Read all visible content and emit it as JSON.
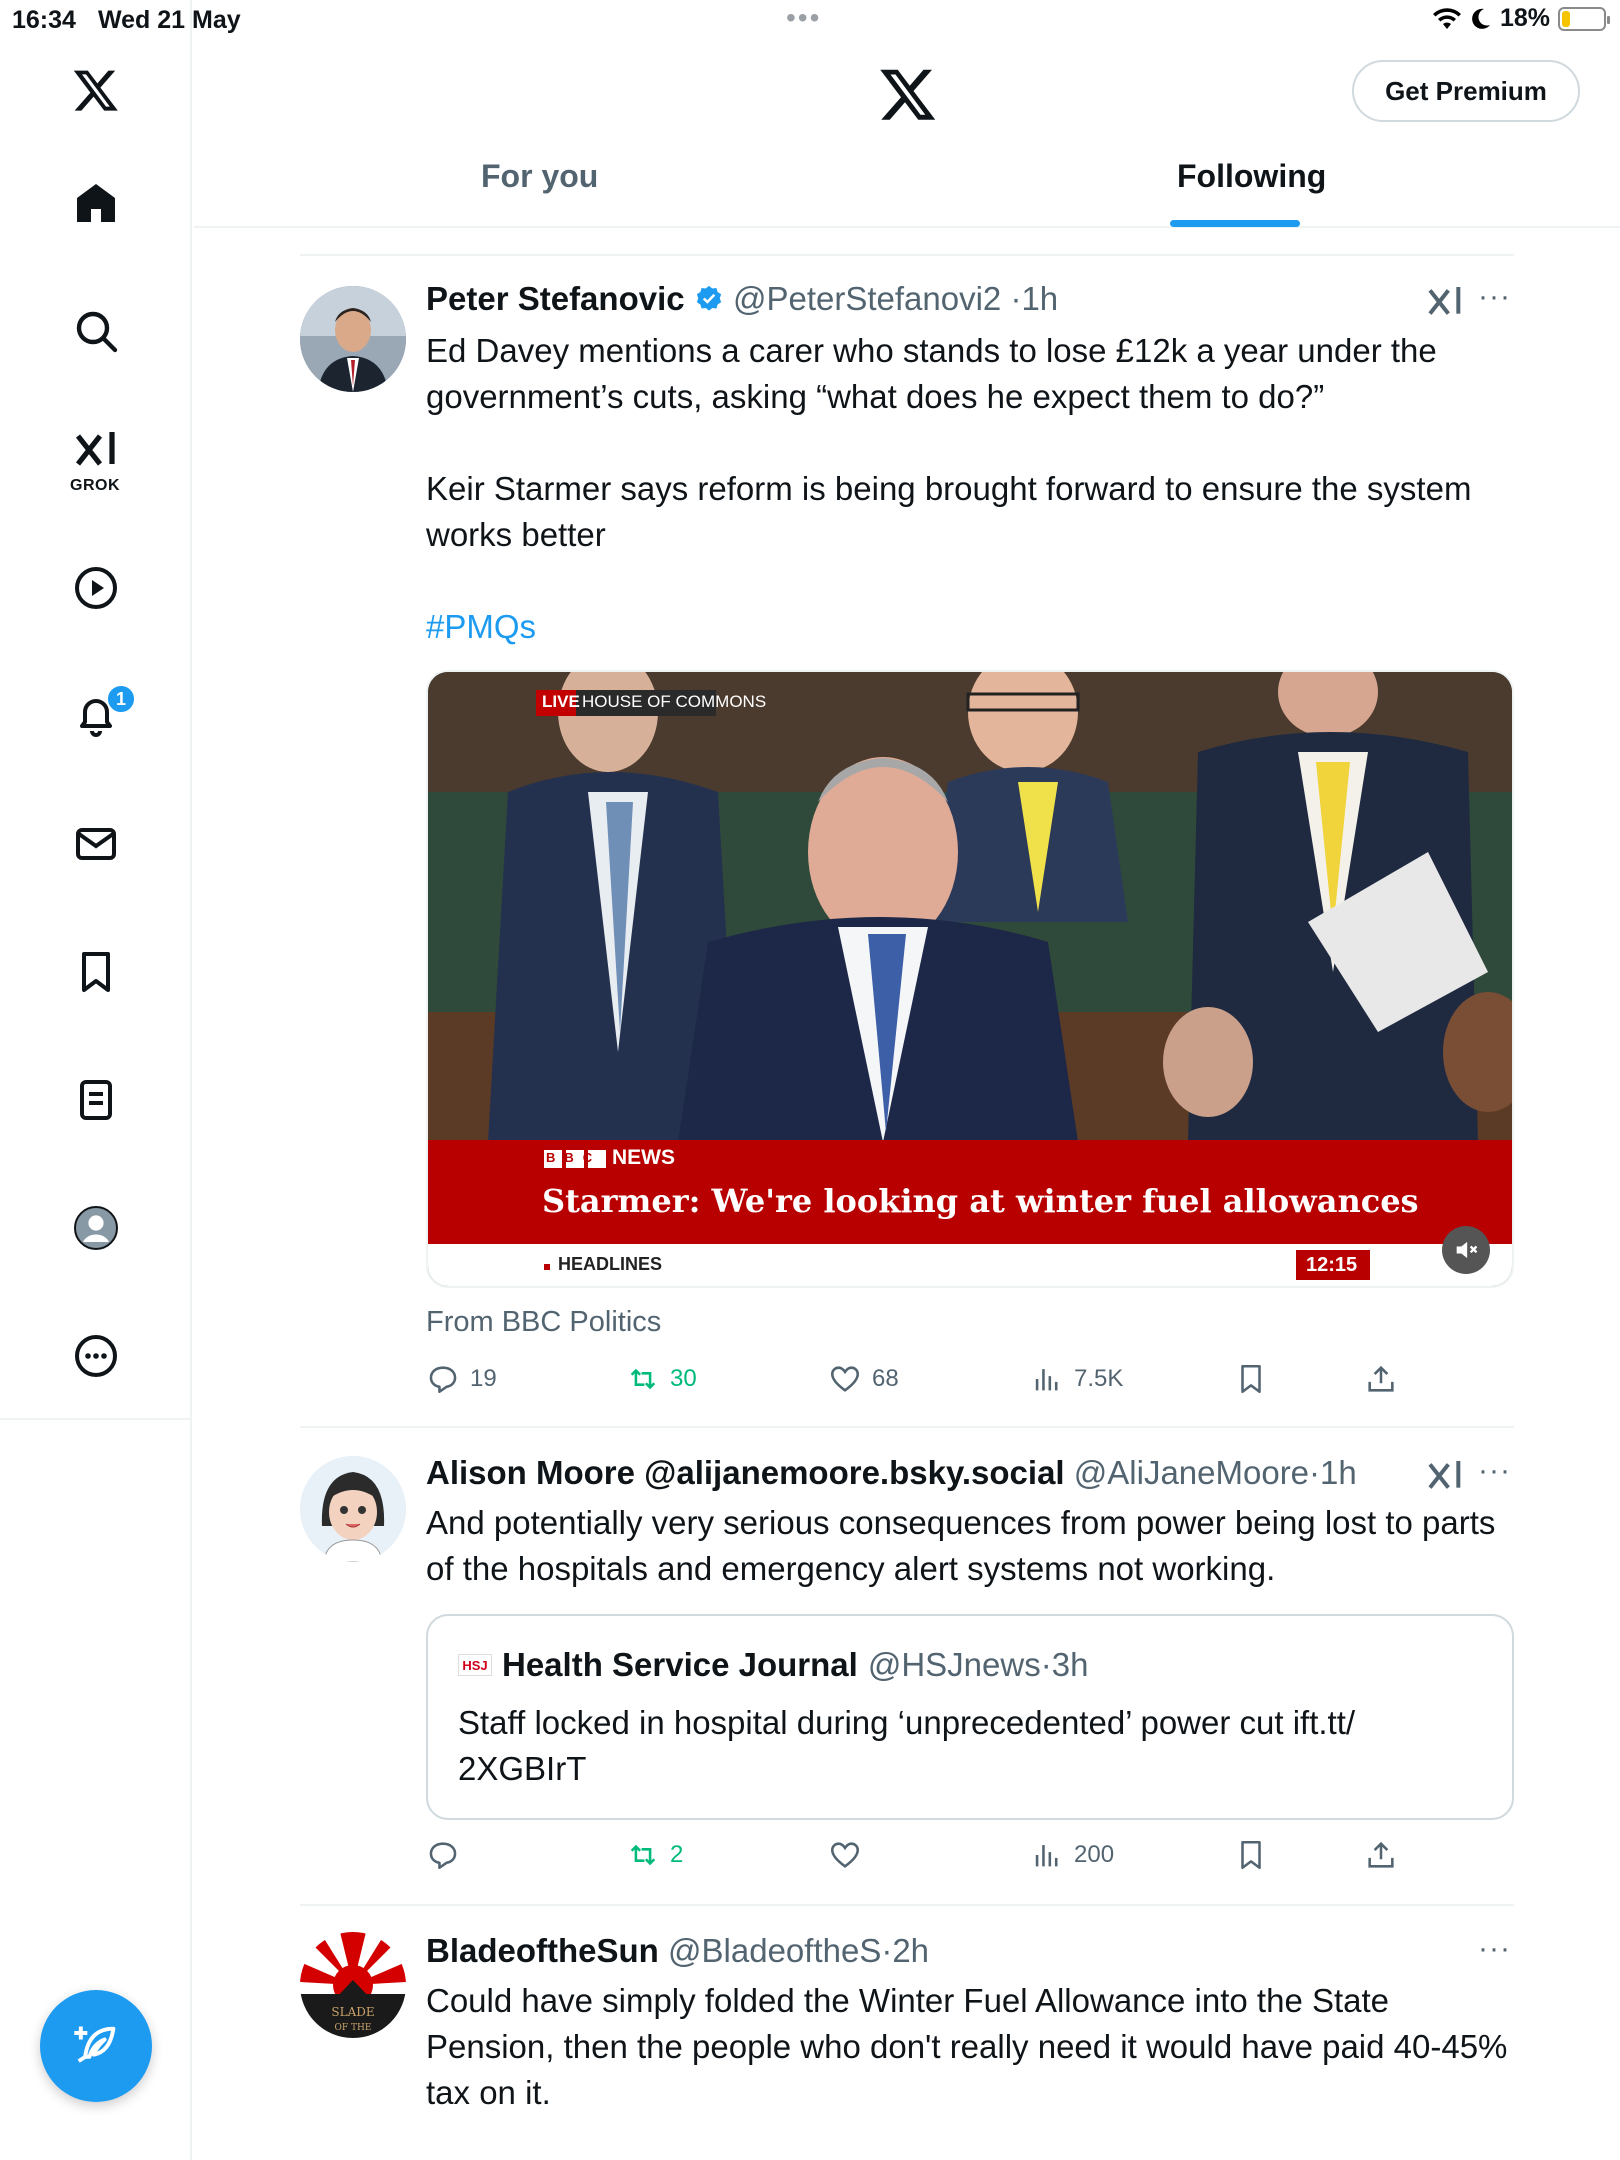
{
  "status_bar": {
    "time": "16:34",
    "date": "Wed 21 May",
    "battery": "18%"
  },
  "sidebar": {
    "grok_label": "GROK",
    "notification_count": "1"
  },
  "header": {
    "premium_label": "Get Premium",
    "tabs": [
      "For you",
      "Following"
    ],
    "active_tab": "Following"
  },
  "posts": [
    {
      "name": "Peter Stefanovic",
      "verified": true,
      "handle": "@PeterStefanovi2",
      "time": "1h",
      "text_p1": "Ed Davey mentions a carer who stands to lose £12k a year under the government’s cuts, asking “what does he expect them to do?”",
      "text_p2": "Keir Starmer says reform is being brought forward to ensure the system works better",
      "hashtag": "#PMQs",
      "media": {
        "live_tag": "LIVE",
        "location_tag": "HOUSE OF COMMONS",
        "channel": "NEWS",
        "headline": "Starmer: We're looking at winter fuel allowances",
        "ticker": "HEADLINES",
        "clock": "12:15"
      },
      "from_label": "From BBC Politics",
      "stats": {
        "replies": "19",
        "reposts": "30",
        "likes": "68",
        "views": "7.5K"
      }
    },
    {
      "name": "Alison Moore @alijanemoore.bsky.social",
      "handle": "@AliJaneMoore",
      "time": "1h",
      "text": "And potentially very serious consequences from power being lost to parts of the hospitals and emergency alert systems not working.",
      "quote": {
        "logo": "HSJ",
        "name": "Health Service Journal",
        "handle": "@HSJnews",
        "time": "3h",
        "text": "Staff locked in hospital during ‘unprecedented’ power cut ift.tt/ 2XGBIrT"
      },
      "stats": {
        "replies": "",
        "reposts": "2",
        "likes": "",
        "views": "200"
      }
    },
    {
      "name": "BladeoftheSun",
      "handle": "@BladeoftheS",
      "time": "2h",
      "text": "Could have simply folded the Winter Fuel Allowance into the State Pension, then the people who don't really need it would have paid 40-45% tax on it."
    }
  ],
  "colors": {
    "accent": "#1d9bf0",
    "repost_green": "#00ba7c",
    "muted": "#536471",
    "bbc_red": "#b80000"
  }
}
